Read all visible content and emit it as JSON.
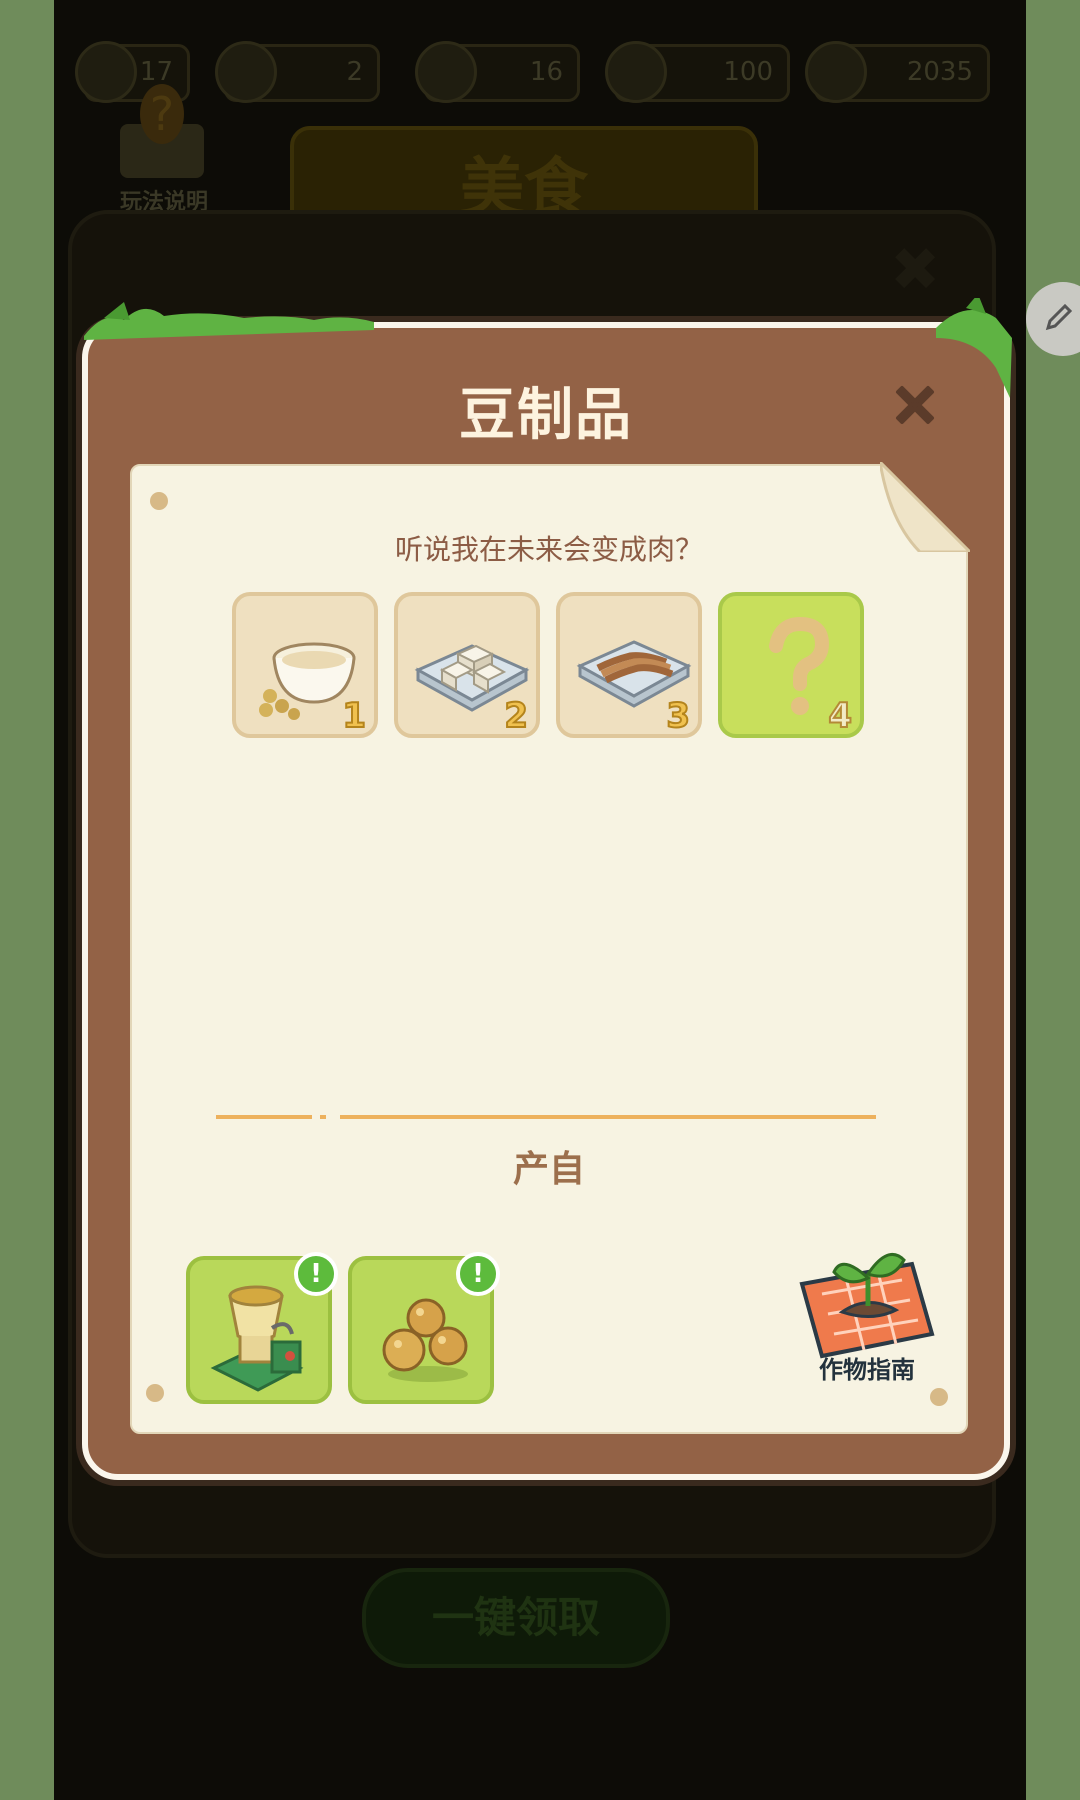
{
  "background_game": {
    "hud": [
      {
        "icon": "level-icon",
        "value": "17"
      },
      {
        "icon": "heart-icon",
        "value": "2"
      },
      {
        "icon": "person-icon",
        "value": "16"
      },
      {
        "icon": "key-icon",
        "value": "100"
      },
      {
        "icon": "coin-icon",
        "value": "2035"
      }
    ],
    "help_label": "玩法说明",
    "panel_title": "美食",
    "claim_all_label": "一键领取"
  },
  "modal": {
    "title": "豆制品",
    "subtitle": "听说我在未来会变成肉？",
    "products": [
      {
        "icon": "soy-milk-icon",
        "number": "1",
        "locked": false
      },
      {
        "icon": "tofu-icon",
        "number": "2",
        "locked": false
      },
      {
        "icon": "tofu-skin-icon",
        "number": "3",
        "locked": false
      },
      {
        "icon": "question-mark-icon",
        "number": "4",
        "locked": true
      }
    ],
    "source_label": "产自",
    "sources": [
      {
        "icon": "grinder-machine-icon",
        "badge": "!"
      },
      {
        "icon": "soybeans-icon",
        "badge": "!"
      }
    ],
    "guide_label": "作物指南"
  },
  "colors": {
    "frame": "#936246",
    "paper": "#f7f3e2",
    "accent_green": "#b9d85a",
    "text_brown": "#8c5c45"
  }
}
